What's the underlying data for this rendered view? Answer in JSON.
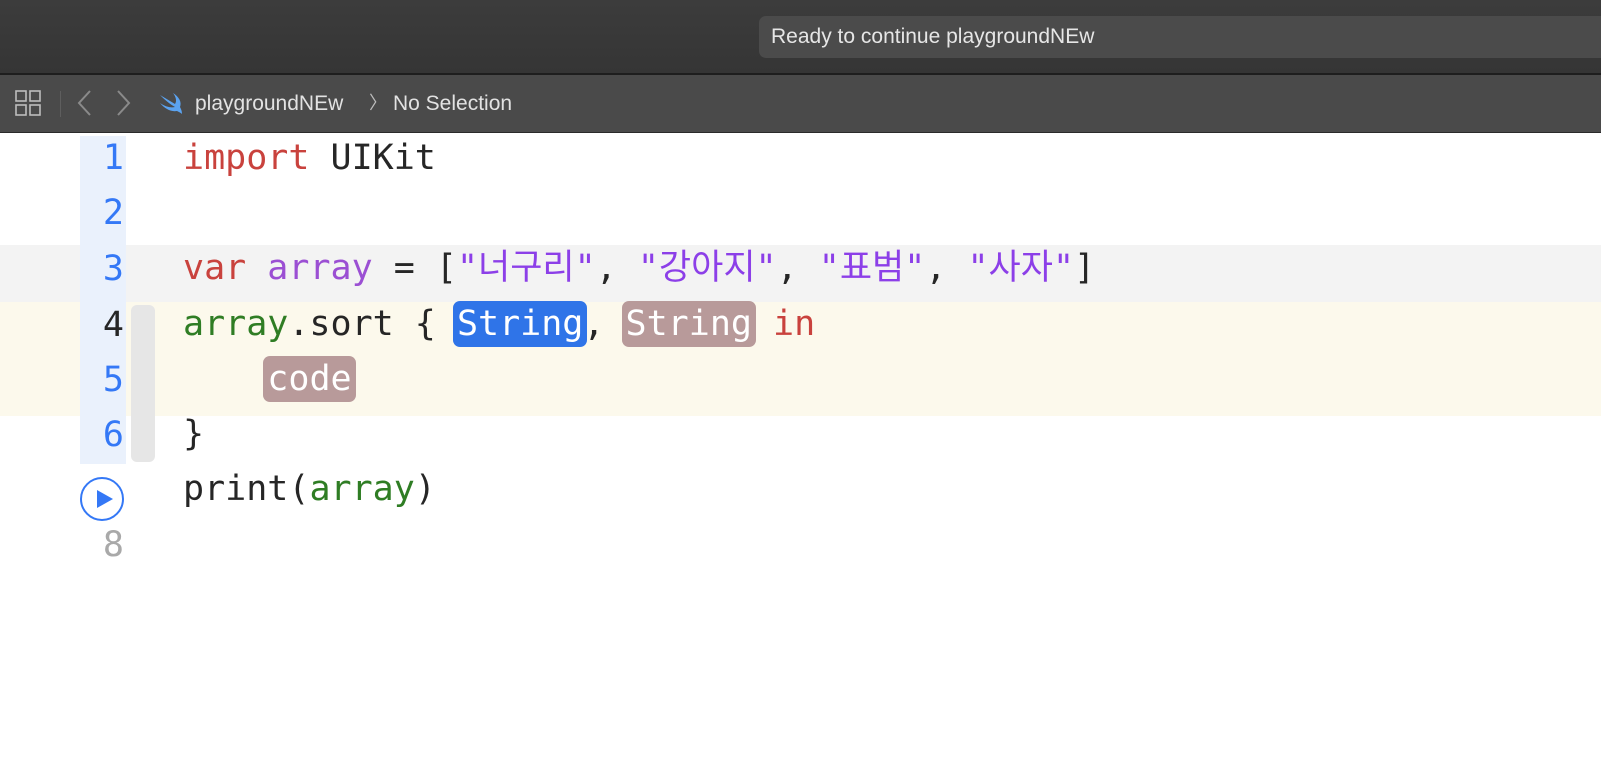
{
  "window": {
    "status_text": "Ready to continue playgroundNEw"
  },
  "jumpbar": {
    "file_name": "playgroundNEw",
    "chevron": "〉",
    "selection": "No Selection",
    "icons": [
      "grid-icon",
      "back-chevron-icon",
      "forward-chevron-icon",
      "swift-icon"
    ]
  },
  "editor": {
    "line_numbers": [
      "1",
      "2",
      "3",
      "4",
      "5",
      "6",
      "",
      "8"
    ],
    "current_line": 4,
    "run_line": 7,
    "lines": {
      "l1": {
        "kw": "import",
        "rest": " UIKit"
      },
      "l3": {
        "kw": "var",
        "name": "array",
        "eq": " = [",
        "s1": "\"너구리\"",
        "c1": ", ",
        "s2": "\"강아지\"",
        "c2": ", ",
        "s3": "\"표범\"",
        "c3": ", ",
        "s4": "\"사자\"",
        "close": "]"
      },
      "l4": {
        "obj": "array",
        "method": ".sort { ",
        "ph1": "String",
        "comma": ", ",
        "ph2": "String",
        "kw": "in"
      },
      "l5": {
        "indent": "    ",
        "ph": "code"
      },
      "l6": {
        "text": "}"
      },
      "l7": {
        "fn": "print(",
        "arg": "array",
        "close": ")"
      }
    },
    "colors": {
      "keyword": "#c9423d",
      "variable": "#9b4fd3",
      "string": "#8c3fe8",
      "identifier": "#2f7d24",
      "line_number": "#3478f6",
      "selected_placeholder": "#2f74e8",
      "placeholder": "#b89a9a"
    }
  }
}
